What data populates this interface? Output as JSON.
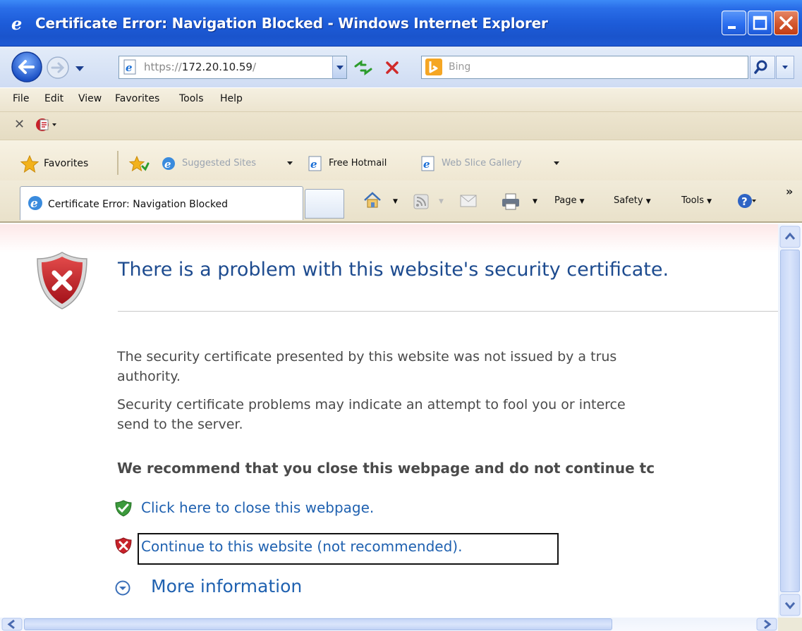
{
  "window": {
    "title": "Certificate Error: Navigation Blocked - Windows Internet Explorer"
  },
  "address_bar": {
    "url_prefix": "https://",
    "url_host": "172.20.10.59",
    "url_suffix": "/"
  },
  "search": {
    "placeholder": "Bing"
  },
  "menu": {
    "items": [
      "File",
      "Edit",
      "View",
      "Favorites",
      "Tools",
      "Help"
    ]
  },
  "favorites_bar": {
    "label": "Favorites",
    "links": [
      "Suggested Sites",
      "Free Hotmail",
      "Web Slice Gallery"
    ]
  },
  "tab": {
    "title": "Certificate Error: Navigation Blocked"
  },
  "command_bar": {
    "page": "Page",
    "safety": "Safety",
    "tools": "Tools",
    "more": "»"
  },
  "content": {
    "heading": "There is a problem with this website's security certificate.",
    "para1_line1": "The security certificate presented by this website was not issued by a trus",
    "para1_line2": "authority.",
    "para2_line1": "Security certificate problems may indicate an attempt to fool you or interce",
    "para2_line2": "send to the server.",
    "recommendation": "We recommend that you close this webpage and do not continue tc",
    "close_link": "Click here to close this webpage.",
    "continue_link": "Continue to this website (not recommended).",
    "more_info": "More information"
  },
  "colors": {
    "titlebar": "#1d5cd9",
    "heading": "#1d4b8f",
    "link": "#1f61b0",
    "shield_red": "#c8222a",
    "shield_green": "#3c9a3c"
  }
}
